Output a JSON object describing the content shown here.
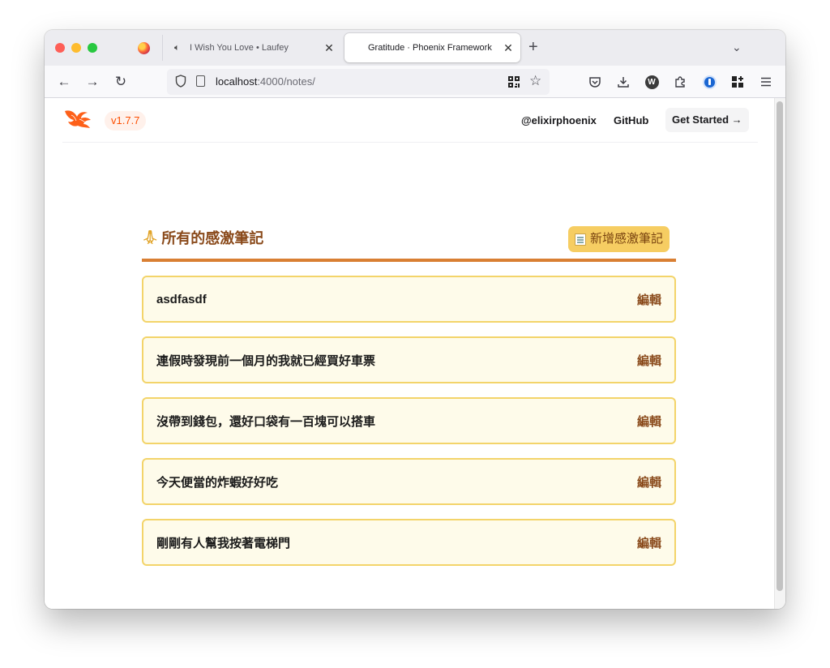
{
  "browser": {
    "tabs": [
      {
        "label": "I Wish You Love • Laufey",
        "close": "✕"
      },
      {
        "label": "Gratitude · Phoenix Framework",
        "close": "✕"
      }
    ],
    "new_tab": "+",
    "tab_list": "⌄",
    "url_host": "localhost",
    "url_path": ":4000/notes/"
  },
  "header": {
    "version": "v1.7.7",
    "nav": [
      "@elixirphoenix",
      "GitHub"
    ],
    "cta": "Get Started →"
  },
  "notes": {
    "title": "所有的感激筆記",
    "add_label": "新增感激筆記",
    "edit_label": "編輯",
    "items": [
      "asdfasdf",
      "連假時發現前一個月的我就已經買好車票",
      "沒帶到錢包，還好口袋有一百塊可以搭車",
      "今天便當的炸蝦好好吃",
      "剛剛有人幫我按著電梯門"
    ]
  },
  "colors": {
    "accent": "#d97f33",
    "card_bg": "#fefbea",
    "card_border": "#f3d46a",
    "button_bg": "#f6cd62",
    "phoenix_orange": "#fd4f00"
  }
}
